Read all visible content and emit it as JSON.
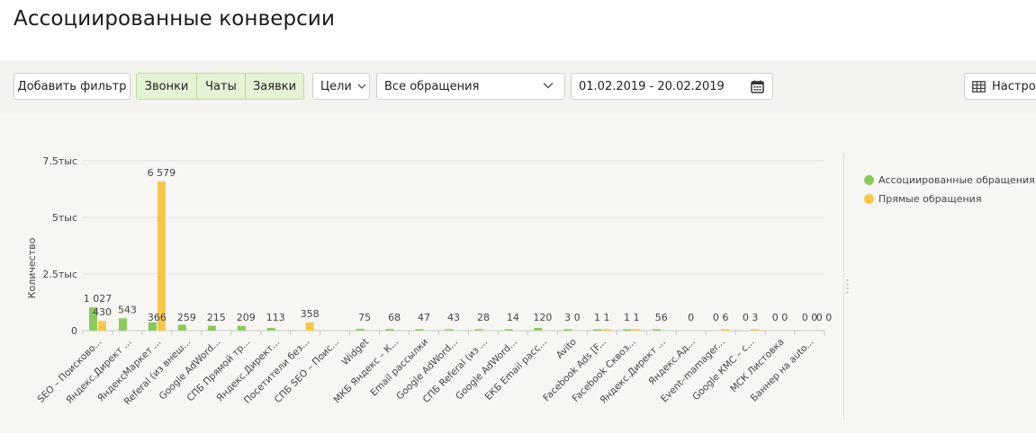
{
  "page": {
    "title": "Ассоциированные конверсии"
  },
  "toolbar": {
    "add_filter": "Добавить фильтр",
    "segments": [
      "Звонки",
      "Чаты",
      "Заявки"
    ],
    "goals": "Цели",
    "appeals": "Все обращения",
    "date_range": "01.02.2019 - 20.02.2019",
    "settings": "Настрои"
  },
  "colors": {
    "associated": "#8bc95d",
    "direct": "#f5c84c"
  },
  "icons": [
    "chevron-down-icon",
    "calendar-icon",
    "table-settings-icon"
  ],
  "chart_data": {
    "type": "bar",
    "ylabel": "Количество",
    "ylim": [
      0,
      7500
    ],
    "yticks": [
      {
        "value": 0,
        "label": "0"
      },
      {
        "value": 2500,
        "label": "2.5тыс"
      },
      {
        "value": 5000,
        "label": "5тыс"
      },
      {
        "value": 7500,
        "label": "7.5тыс"
      }
    ],
    "legend_position": "right",
    "categories": [
      "SEO – Поисково...",
      "Яндекс.Директ ...",
      "ЯндексМаркет ...",
      "Referal (из внеш...",
      "Google AdWord...",
      "СПБ Прямой тр...",
      "Яндекс.Директ...",
      "Посетители без...",
      "СПБ SEO – Поис...",
      "Widget",
      "МКБ Яндекс – К...",
      "Email рассылки",
      "Google AdWord...",
      "СПБ Referal (из ...",
      "Google AdWord...",
      "ЕКБ Email расс...",
      "Avito",
      "Facebook Ads [F...",
      "Facebook Сквоз...",
      "Яндекс.Директ ...",
      "Яндекс.Ад...",
      "Event–mamager...",
      "Google КМС – с...",
      "МСК Листовка",
      "Баннер на auto..."
    ],
    "series": [
      {
        "name": "Ассоциированные обращения",
        "values": [
          1027,
          543,
          366,
          259,
          215,
          209,
          113,
          0,
          0,
          75,
          68,
          47,
          43,
          28,
          14,
          120,
          3,
          1,
          1,
          56,
          0,
          0,
          0,
          0,
          0
        ]
      },
      {
        "name": "Прямые обращения",
        "values": [
          430,
          0,
          6579,
          0,
          0,
          0,
          0,
          358,
          0,
          0,
          0,
          0,
          0,
          0,
          0,
          0,
          0,
          1,
          1,
          0,
          0,
          6,
          3,
          0,
          0
        ]
      }
    ],
    "data_labels": [
      "1 027",
      "543",
      "366",
      "259",
      "215",
      "209",
      "113",
      "",
      "",
      "75",
      "68",
      "47",
      "43",
      "28",
      "14",
      "120",
      "3 0",
      "1 1",
      "1 1",
      "56",
      "0",
      "0 6",
      "0 3",
      "0 0",
      "0 0"
    ],
    "direct_labels": {
      "0": "430",
      "2": "6 579",
      "7": "358"
    },
    "extra_labels": [
      "0 0"
    ]
  }
}
